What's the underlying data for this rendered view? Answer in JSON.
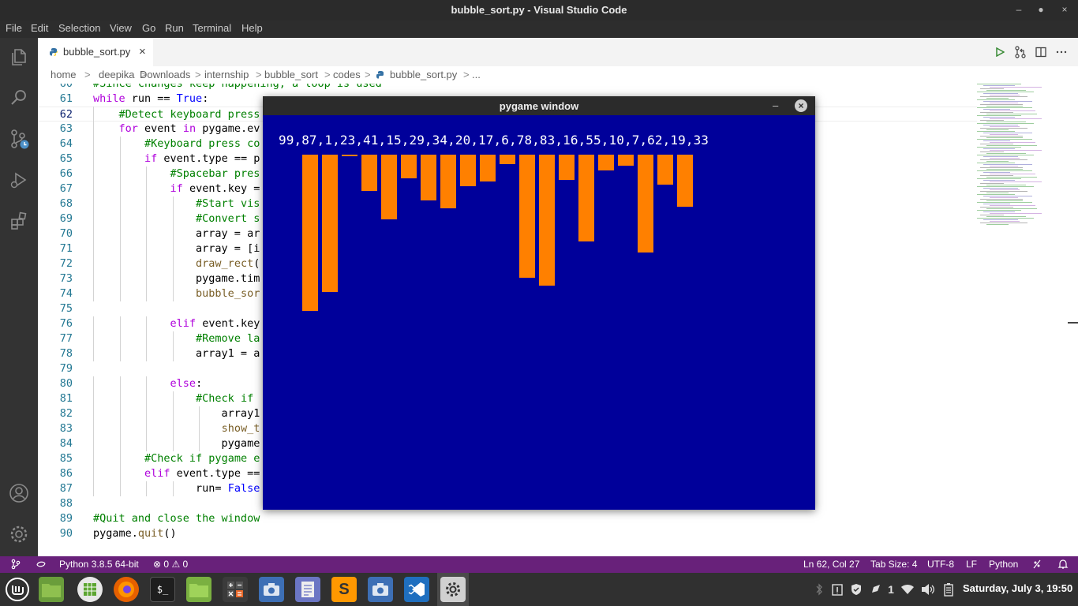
{
  "window": {
    "title": "bubble_sort.py - Visual Studio Code",
    "controls": [
      "–",
      "●",
      "×"
    ]
  },
  "menu": [
    "File",
    "Edit",
    "Selection",
    "View",
    "Go",
    "Run",
    "Terminal",
    "Help"
  ],
  "tab": {
    "label": "bubble_sort.py",
    "close": "×"
  },
  "breadcrumb": [
    "home",
    "deepika",
    "Downloads",
    "internship",
    "bubble_sort",
    "codes",
    "bubble_sort.py",
    "..."
  ],
  "breadcrumb_sep": ">",
  "editor": {
    "current_line": "62",
    "lines": [
      {
        "n": "60",
        "code": "#Since changes keep happening, a loop is used"
      },
      {
        "n": "61",
        "code": "while run == True:"
      },
      {
        "n": "62",
        "code": "    #Detect keyboard press"
      },
      {
        "n": "63",
        "code": "    for event in pygame.ev"
      },
      {
        "n": "64",
        "code": "        #Keyboard press co"
      },
      {
        "n": "65",
        "code": "        if event.type == p"
      },
      {
        "n": "66",
        "code": "            #Spacebar pres"
      },
      {
        "n": "67",
        "code": "            if event.key ="
      },
      {
        "n": "68",
        "code": "                #Start vis"
      },
      {
        "n": "69",
        "code": "                #Convert s"
      },
      {
        "n": "70",
        "code": "                array = ar"
      },
      {
        "n": "71",
        "code": "                array = [i"
      },
      {
        "n": "72",
        "code": "                draw_rect("
      },
      {
        "n": "73",
        "code": "                pygame.tim"
      },
      {
        "n": "74",
        "code": "                bubble_sor"
      },
      {
        "n": "75",
        "code": ""
      },
      {
        "n": "76",
        "code": "            elif event.key"
      },
      {
        "n": "77",
        "code": "                #Remove la"
      },
      {
        "n": "78",
        "code": "                array1 = a"
      },
      {
        "n": "79",
        "code": ""
      },
      {
        "n": "80",
        "code": "            else:"
      },
      {
        "n": "81",
        "code": "                #Check if"
      },
      {
        "n": "82",
        "code": "                    array1"
      },
      {
        "n": "83",
        "code": "                    show_t"
      },
      {
        "n": "84",
        "code": "                    pygame"
      },
      {
        "n": "85",
        "code": "        #Check if pygame e"
      },
      {
        "n": "86",
        "code": "        elif event.type =="
      },
      {
        "n": "87",
        "code": "                run= False"
      },
      {
        "n": "88",
        "code": ""
      },
      {
        "n": "89",
        "code": "#Quit and close the window"
      },
      {
        "n": "90",
        "code": "pygame.quit()"
      }
    ]
  },
  "pygame": {
    "title": "pygame window",
    "minimize": "–",
    "close": "×",
    "array_text": "99,87,1,23,41,15,29,34,20,17,6,78,83,16,55,10,7,62,19,33",
    "values": [
      99,
      87,
      1,
      23,
      41,
      15,
      29,
      34,
      20,
      17,
      6,
      78,
      83,
      16,
      55,
      10,
      7,
      62,
      19,
      33
    ],
    "background": "#00009a",
    "bar_color": "#ff8000"
  },
  "status": {
    "python": "Python 3.8.5 64-bit",
    "errors": "0",
    "warnings": "0",
    "position": "Ln 62, Col 27",
    "tab_size": "Tab Size: 4",
    "encoding": "UTF-8",
    "eol": "LF",
    "language": "Python",
    "color": "#68217a"
  },
  "taskbar": {
    "clock": "Saturday, July 3, 19:50",
    "notification_count": "1",
    "apps": [
      "linux-mint-menu-icon",
      "files-icon",
      "spreadsheet-icon",
      "firefox-icon",
      "terminal-icon",
      "folder-icon",
      "calculator-icon",
      "screenshot-icon",
      "text-editor-icon",
      "sublime-text-icon",
      "screenshot-icon",
      "vscode-icon",
      "settings-icon"
    ]
  },
  "colors": {
    "comment": "#008000",
    "keyword": "#af00db",
    "builtin": "#0000ff",
    "function": "#795e26",
    "line_number": "#237893"
  }
}
